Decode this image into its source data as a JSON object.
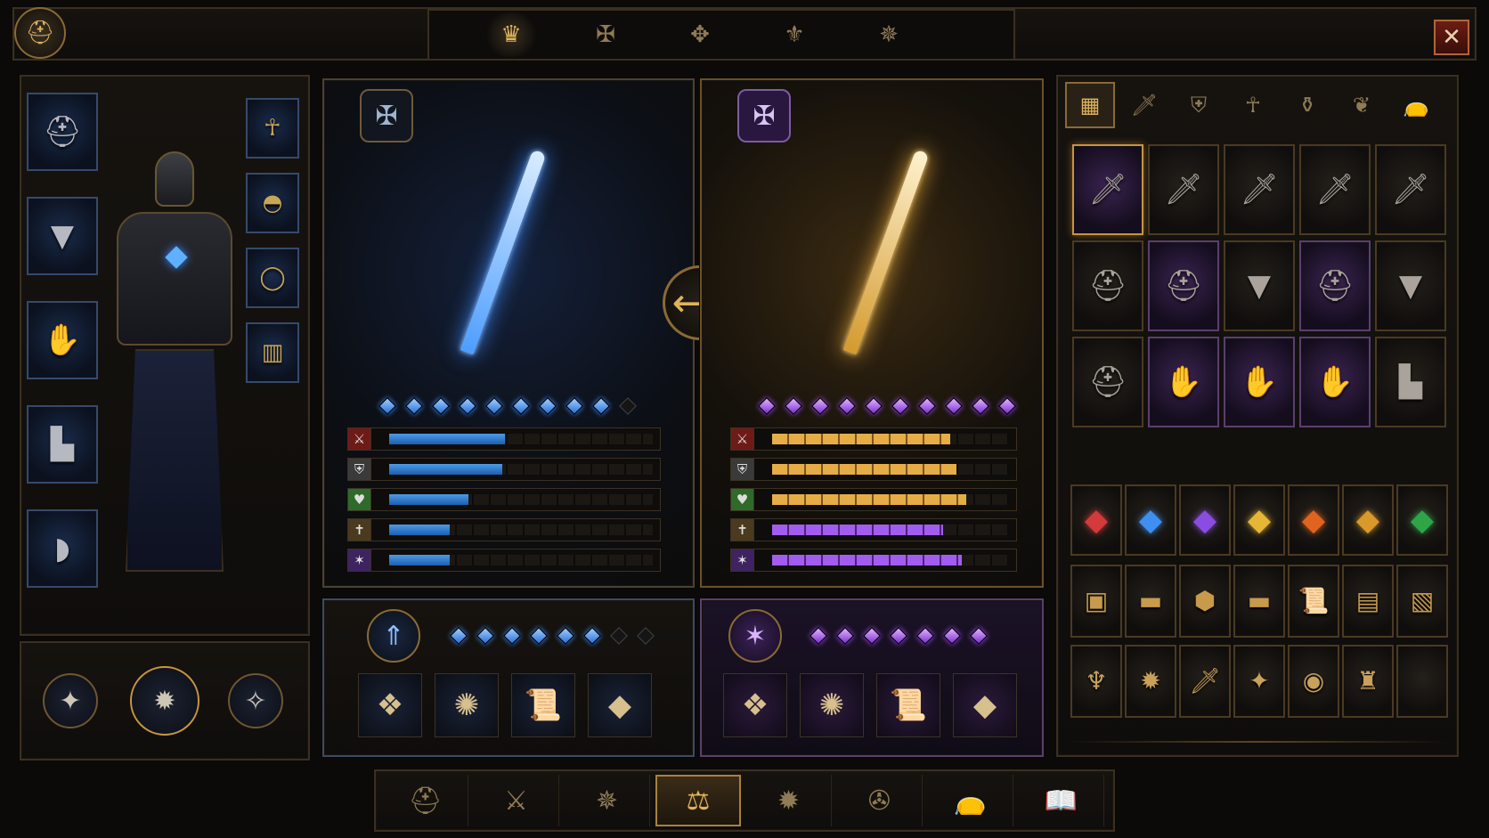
{
  "header": {
    "emblem_icon": "helm-emblem-icon",
    "close_icon": "close-icon",
    "tabs": [
      {
        "icon": "crown-tab-icon",
        "glyph": "♛",
        "active": true
      },
      {
        "icon": "rune-tab-icon",
        "glyph": "✠",
        "active": false
      },
      {
        "icon": "sigil-tab-icon",
        "glyph": "✥",
        "active": false
      },
      {
        "icon": "crest-tab-icon",
        "glyph": "⚜",
        "active": false
      },
      {
        "icon": "seal-tab-icon",
        "glyph": "✵",
        "active": false
      }
    ]
  },
  "equipment": {
    "left_slots": [
      {
        "icon": "helmet-icon",
        "glyph": "⛑"
      },
      {
        "icon": "chest-armor-icon",
        "glyph": "▼"
      },
      {
        "icon": "gauntlet-icon",
        "glyph": "✋"
      },
      {
        "icon": "boots-icon",
        "glyph": "▙"
      },
      {
        "icon": "bracer-icon",
        "glyph": "◗"
      }
    ],
    "right_slots": [
      {
        "icon": "amulet-icon",
        "glyph": "☥"
      },
      {
        "icon": "shoulder-icon",
        "glyph": "◓"
      },
      {
        "icon": "ring-icon",
        "glyph": "◯"
      },
      {
        "icon": "belt-icon",
        "glyph": "▥"
      }
    ],
    "skills": [
      {
        "icon": "skill-compass-icon",
        "glyph": "✦"
      },
      {
        "icon": "skill-star-icon",
        "glyph": "✹"
      },
      {
        "icon": "skill-cross-icon",
        "glyph": "✧"
      }
    ]
  },
  "compare": {
    "left": {
      "badge_icon": "frost-rune-icon",
      "item_icon": "frost-sword-icon",
      "stars_filled": 9,
      "stars_total": 10,
      "stats": [
        {
          "icon": "attack-icon",
          "glyph": "⚔",
          "value": 0.44
        },
        {
          "icon": "defense-icon",
          "glyph": "⛨",
          "value": 0.43
        },
        {
          "icon": "health-icon",
          "glyph": "♥",
          "value": 0.3
        },
        {
          "icon": "holy-icon",
          "glyph": "✝",
          "value": 0.23
        },
        {
          "icon": "arcane-icon",
          "glyph": "✶",
          "value": 0.23
        }
      ],
      "upgrade_icon": "upgrade-arrow-icon",
      "upgrade_filled": 6,
      "upgrade_total": 8,
      "materials": [
        {
          "icon": "blue-crystal-icon",
          "glyph": "❖"
        },
        {
          "icon": "frost-orb-icon",
          "glyph": "✺"
        },
        {
          "icon": "scroll-icon",
          "glyph": "📜"
        },
        {
          "icon": "purple-shard-icon",
          "glyph": "◆"
        }
      ]
    },
    "right": {
      "badge_icon": "arcane-rune-icon",
      "item_icon": "golden-sword-icon",
      "stars_filled": 10,
      "stars_total": 10,
      "stats": [
        {
          "icon": "attack-icon",
          "glyph": "⚔",
          "value": 0.75,
          "color": "gold"
        },
        {
          "icon": "defense-icon",
          "glyph": "⛨",
          "value": 0.78,
          "color": "gold"
        },
        {
          "icon": "health-icon",
          "glyph": "♥",
          "value": 0.82,
          "color": "gold"
        },
        {
          "icon": "holy-icon",
          "glyph": "✝",
          "value": 0.72,
          "color": "purple"
        },
        {
          "icon": "arcane-icon",
          "glyph": "✶",
          "value": 0.8,
          "color": "purple"
        }
      ],
      "upgrade_icon": "arcane-sigil-icon",
      "upgrade_filled": 7,
      "upgrade_total": 7,
      "materials": [
        {
          "icon": "amethyst-cluster-icon",
          "glyph": "❖"
        },
        {
          "icon": "compass-icon",
          "glyph": "✺"
        },
        {
          "icon": "arcane-scroll-icon",
          "glyph": "📜"
        },
        {
          "icon": "gold-shard-icon",
          "glyph": "◆"
        }
      ]
    },
    "swap_icon": "swap-arrows-icon",
    "swap_glyph": "⟷"
  },
  "inventory": {
    "tabs": [
      {
        "icon": "grid-all-icon",
        "glyph": "▦",
        "active": true
      },
      {
        "icon": "sword-tab-icon",
        "glyph": "🗡",
        "active": false
      },
      {
        "icon": "shield-tab-icon",
        "glyph": "⛨",
        "active": false
      },
      {
        "icon": "amulet-tab-icon",
        "glyph": "☥",
        "active": false
      },
      {
        "icon": "potion-tab-icon",
        "glyph": "⚱",
        "active": false
      },
      {
        "icon": "leaf-tab-icon",
        "glyph": "❦",
        "active": false
      },
      {
        "icon": "bag-tab-icon",
        "glyph": "👝",
        "active": false
      }
    ],
    "gear_rows": [
      [
        {
          "icon": "golden-sword-icon",
          "glyph": "🗡",
          "style": "purple gold"
        },
        {
          "icon": "steel-sword-icon",
          "glyph": "🗡",
          "style": "plain"
        },
        {
          "icon": "steel-sword-icon",
          "glyph": "🗡",
          "style": "plain"
        },
        {
          "icon": "steel-sword-icon",
          "glyph": "🗡",
          "style": "plain"
        },
        {
          "icon": "steel-sword-icon",
          "glyph": "🗡",
          "style": "plain"
        }
      ],
      [
        {
          "icon": "helmet-icon",
          "glyph": "⛑",
          "style": "plain"
        },
        {
          "icon": "helmet-icon",
          "glyph": "⛑",
          "style": "purple"
        },
        {
          "icon": "chest-armor-icon",
          "glyph": "▼",
          "style": "plain"
        },
        {
          "icon": "helmet-icon",
          "glyph": "⛑",
          "style": "purple"
        },
        {
          "icon": "chest-armor-icon",
          "glyph": "▼",
          "style": "plain"
        }
      ],
      [
        {
          "icon": "helmet-icon",
          "glyph": "⛑",
          "style": "plain"
        },
        {
          "icon": "gauntlet-icon",
          "glyph": "✋",
          "style": "purple"
        },
        {
          "icon": "gauntlet-icon",
          "glyph": "✋",
          "style": "purple"
        },
        {
          "icon": "gauntlet-icon",
          "glyph": "✋",
          "style": "purple"
        },
        {
          "icon": "boots-icon",
          "glyph": "▙",
          "style": "plain"
        }
      ]
    ],
    "gem_row": [
      {
        "icon": "ruby-icon",
        "glyph": "◆",
        "color": "#d53a3a"
      },
      {
        "icon": "sapphire-icon",
        "glyph": "◆",
        "color": "#3f8ff0"
      },
      {
        "icon": "amethyst-icon",
        "glyph": "◆",
        "color": "#8a4de0"
      },
      {
        "icon": "topaz-icon",
        "glyph": "◆",
        "color": "#e6b637"
      },
      {
        "icon": "fire-gem-icon",
        "glyph": "◆",
        "color": "#e0641f"
      },
      {
        "icon": "amber-icon",
        "glyph": "◆",
        "color": "#d99a2b"
      },
      {
        "icon": "emerald-icon",
        "glyph": "◆",
        "color": "#2fa54a"
      }
    ],
    "material_row": [
      {
        "icon": "ore-chunk-icon",
        "glyph": "▣"
      },
      {
        "icon": "gold-bar-icon",
        "glyph": "▬"
      },
      {
        "icon": "iron-ingot-icon",
        "glyph": "⬢"
      },
      {
        "icon": "silver-bar-icon",
        "glyph": "▬"
      },
      {
        "icon": "scroll-icon",
        "glyph": "📜"
      },
      {
        "icon": "blueprint-icon",
        "glyph": "▤"
      },
      {
        "icon": "map-scroll-icon",
        "glyph": "▧"
      }
    ],
    "misc_row": [
      {
        "icon": "horn-icon",
        "glyph": "♆"
      },
      {
        "icon": "dark-orb-icon",
        "glyph": "✹"
      },
      {
        "icon": "dagger-icon",
        "glyph": "🗡"
      },
      {
        "icon": "gold-trinket-icon",
        "glyph": "✦"
      },
      {
        "icon": "round-shield-icon",
        "glyph": "◉"
      },
      {
        "icon": "gold-idol-icon",
        "glyph": "♜"
      },
      {
        "icon": "empty-slot",
        "glyph": ""
      }
    ]
  },
  "bottom_nav": [
    {
      "icon": "helmet-nav-icon",
      "glyph": "⛑",
      "active": false
    },
    {
      "icon": "crossed-swords-icon",
      "glyph": "⚔",
      "active": false
    },
    {
      "icon": "compass-nav-icon",
      "glyph": "✵",
      "active": false
    },
    {
      "icon": "scales-icon",
      "glyph": "⚖",
      "active": true
    },
    {
      "icon": "spiked-orb-icon",
      "glyph": "✹",
      "active": false
    },
    {
      "icon": "rune-wheel-icon",
      "glyph": "✇",
      "active": false
    },
    {
      "icon": "bag-nav-icon",
      "glyph": "👝",
      "active": false
    },
    {
      "icon": "book-icon",
      "glyph": "📖",
      "active": false
    }
  ]
}
